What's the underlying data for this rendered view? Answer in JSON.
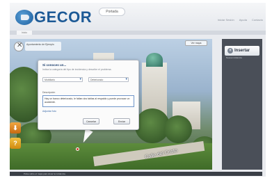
{
  "header": {
    "logo_text": "GECOR",
    "home_button": "Portada",
    "top_links": [
      "Iniciar Sesión",
      "Ayuda",
      "Contacto"
    ],
    "tab_label": "Inicio"
  },
  "viewer": {
    "location_label": "Ayuntamiento de Ejemplo",
    "view_button": "Ver mapa",
    "street_sign": "Calle del Cristo",
    "tools": [
      {
        "icon": "download-icon",
        "label": "Descargar"
      },
      {
        "icon": "help-icon",
        "label": "Ayuda"
      }
    ]
  },
  "dialog": {
    "title": "Si conoces un...",
    "subtitle": "Indica la categoría del tipo de incidencia y describe el problema.",
    "select_a": "Mobiliario",
    "select_b": "Deteriorado",
    "description_label": "Descripción",
    "description_text": "Hay un banco deteriorado, le faltan dos tablas al respaldo y puede provocar un accidente.",
    "attach_link": "Adjuntar foto",
    "cancel_button": "Cancelar",
    "send_button": "Enviar"
  },
  "right_panel": {
    "insert_button": "Insertar",
    "insert_sub": "Nueva incidencia"
  },
  "footer": {
    "text": "Pulse sobre el mapa para situar la incidencia."
  },
  "colors": {
    "brand": "#1d5a96",
    "panel": "#4a4f58",
    "tool_orange": "#e08a20"
  }
}
